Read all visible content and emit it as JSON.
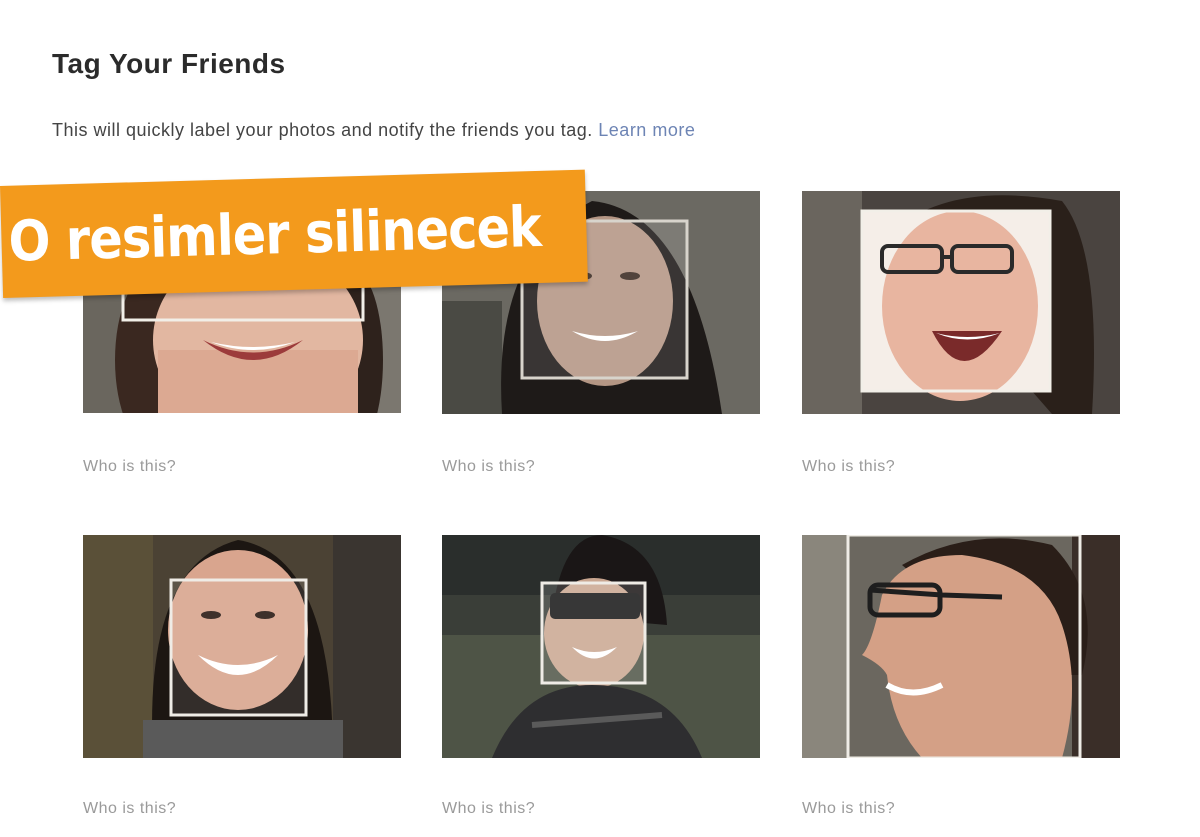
{
  "header": {
    "title": "Tag Your Friends",
    "description": "This will quickly label your photos and notify the friends you tag.",
    "learn_more": "Learn more"
  },
  "banner": {
    "text": "O resimler silinecek",
    "color": "#f39a1c"
  },
  "photos": [
    {
      "caption": "Who is this?"
    },
    {
      "caption": "Who is this?"
    },
    {
      "caption": "Who is this?"
    },
    {
      "caption": "Who is this?"
    },
    {
      "caption": "Who is this?"
    },
    {
      "caption": "Who is this?"
    }
  ],
  "colors": {
    "link": "#6d84b4",
    "caption": "#9a9a9a",
    "title": "#2b2b2b"
  }
}
